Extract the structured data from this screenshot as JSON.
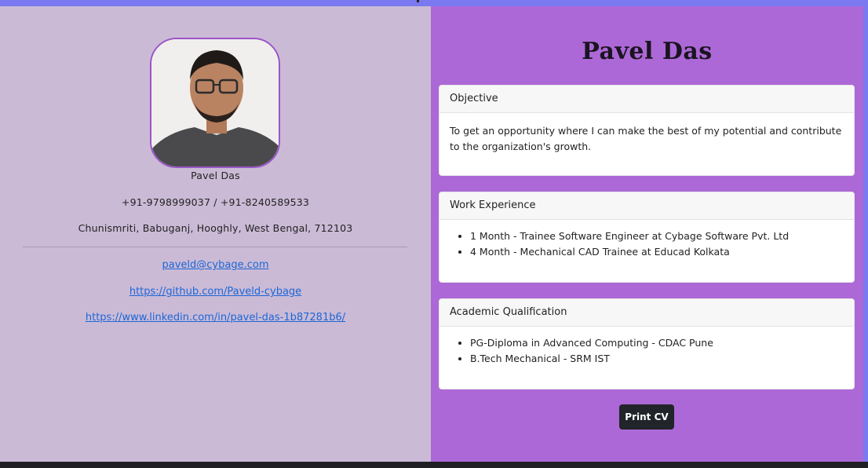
{
  "profile": {
    "name": "Pavel Das",
    "phone": "+91-9798999037 / +91-8240589533",
    "address": "Chunismriti, Babuganj, Hooghly, West Bengal, 712103",
    "email": "paveld@cybage.com",
    "github": "https://github.com/Paveld-cybage",
    "linkedin": "https://www.linkedin.com/in/pavel-das-1b87281b6/"
  },
  "main": {
    "title": "Pavel Das",
    "objective": {
      "header": "Objective",
      "text": "To get an opportunity where I can make the best of my potential and contribute to the organization's growth."
    },
    "work": {
      "header": "Work Experience",
      "items": [
        "1 Month - Trainee Software Engineer at Cybage Software Pvt. Ltd",
        "4 Month - Mechanical CAD Trainee at Educad Kolkata"
      ]
    },
    "academic": {
      "header": "Academic Qualification",
      "items": [
        "PG-Diploma in Advanced Computing - CDAC Pune",
        "B.Tech Mechanical - SRM IST"
      ]
    },
    "print_label": "Print CV"
  },
  "colors": {
    "left_panel": "#cbbad6",
    "right_panel": "#ac68d6",
    "frame": "#7b79f0",
    "link": "#1c67d6",
    "button": "#212529"
  }
}
